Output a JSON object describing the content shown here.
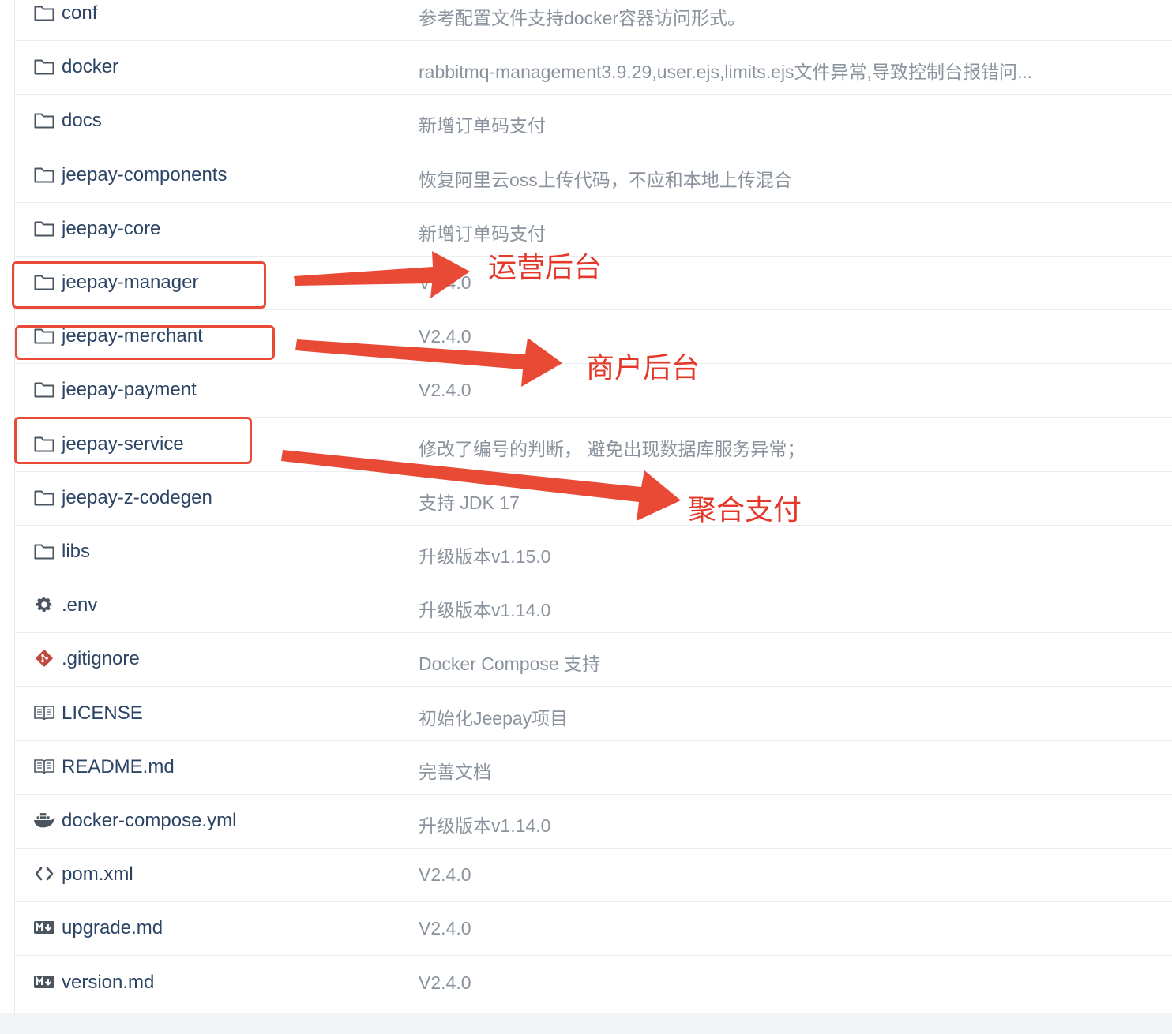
{
  "files": [
    {
      "name": "conf",
      "type": "folder",
      "message": "参考配置文件支持docker容器访问形式。"
    },
    {
      "name": "docker",
      "type": "folder",
      "message": "rabbitmq-management3.9.29,user.ejs,limits.ejs文件异常,导致控制台报错问..."
    },
    {
      "name": "docs",
      "type": "folder",
      "message": "新增订单码支付"
    },
    {
      "name": "jeepay-components",
      "type": "folder",
      "message": "恢复阿里云oss上传代码，不应和本地上传混合"
    },
    {
      "name": "jeepay-core",
      "type": "folder",
      "message": "新增订单码支付"
    },
    {
      "name": "jeepay-manager",
      "type": "folder",
      "message": "V2.4.0"
    },
    {
      "name": "jeepay-merchant",
      "type": "folder",
      "message": "V2.4.0"
    },
    {
      "name": "jeepay-payment",
      "type": "folder",
      "message": "V2.4.0"
    },
    {
      "name": "jeepay-service",
      "type": "folder",
      "message": "修改了编号的判断， 避免出现数据库服务异常；"
    },
    {
      "name": "jeepay-z-codegen",
      "type": "folder",
      "message": "支持 JDK 17"
    },
    {
      "name": "libs",
      "type": "folder",
      "message": "升级版本v1.15.0"
    },
    {
      "name": ".env",
      "type": "gear",
      "message": "升级版本v1.14.0"
    },
    {
      "name": ".gitignore",
      "type": "git",
      "message": "Docker Compose 支持"
    },
    {
      "name": "LICENSE",
      "type": "book",
      "message": "初始化Jeepay项目"
    },
    {
      "name": "README.md",
      "type": "book",
      "message": "完善文档"
    },
    {
      "name": "docker-compose.yml",
      "type": "docker",
      "message": "升级版本v1.14.0"
    },
    {
      "name": "pom.xml",
      "type": "code",
      "message": "V2.4.0"
    },
    {
      "name": "upgrade.md",
      "type": "markdown",
      "message": "V2.4.0"
    },
    {
      "name": "version.md",
      "type": "markdown",
      "message": "V2.4.0"
    }
  ],
  "annotations": [
    {
      "label": "运营后台",
      "target": "jeepay-manager"
    },
    {
      "label": "商户后台",
      "target": "jeepay-merchant"
    },
    {
      "label": "聚合支付",
      "target": "jeepay-service"
    }
  ],
  "colors": {
    "annotation": "#e84a36",
    "file_name": "#2c4464",
    "commit_message": "#8a939d",
    "icon": "#4a5560",
    "git_icon": "#bf4a3c"
  }
}
